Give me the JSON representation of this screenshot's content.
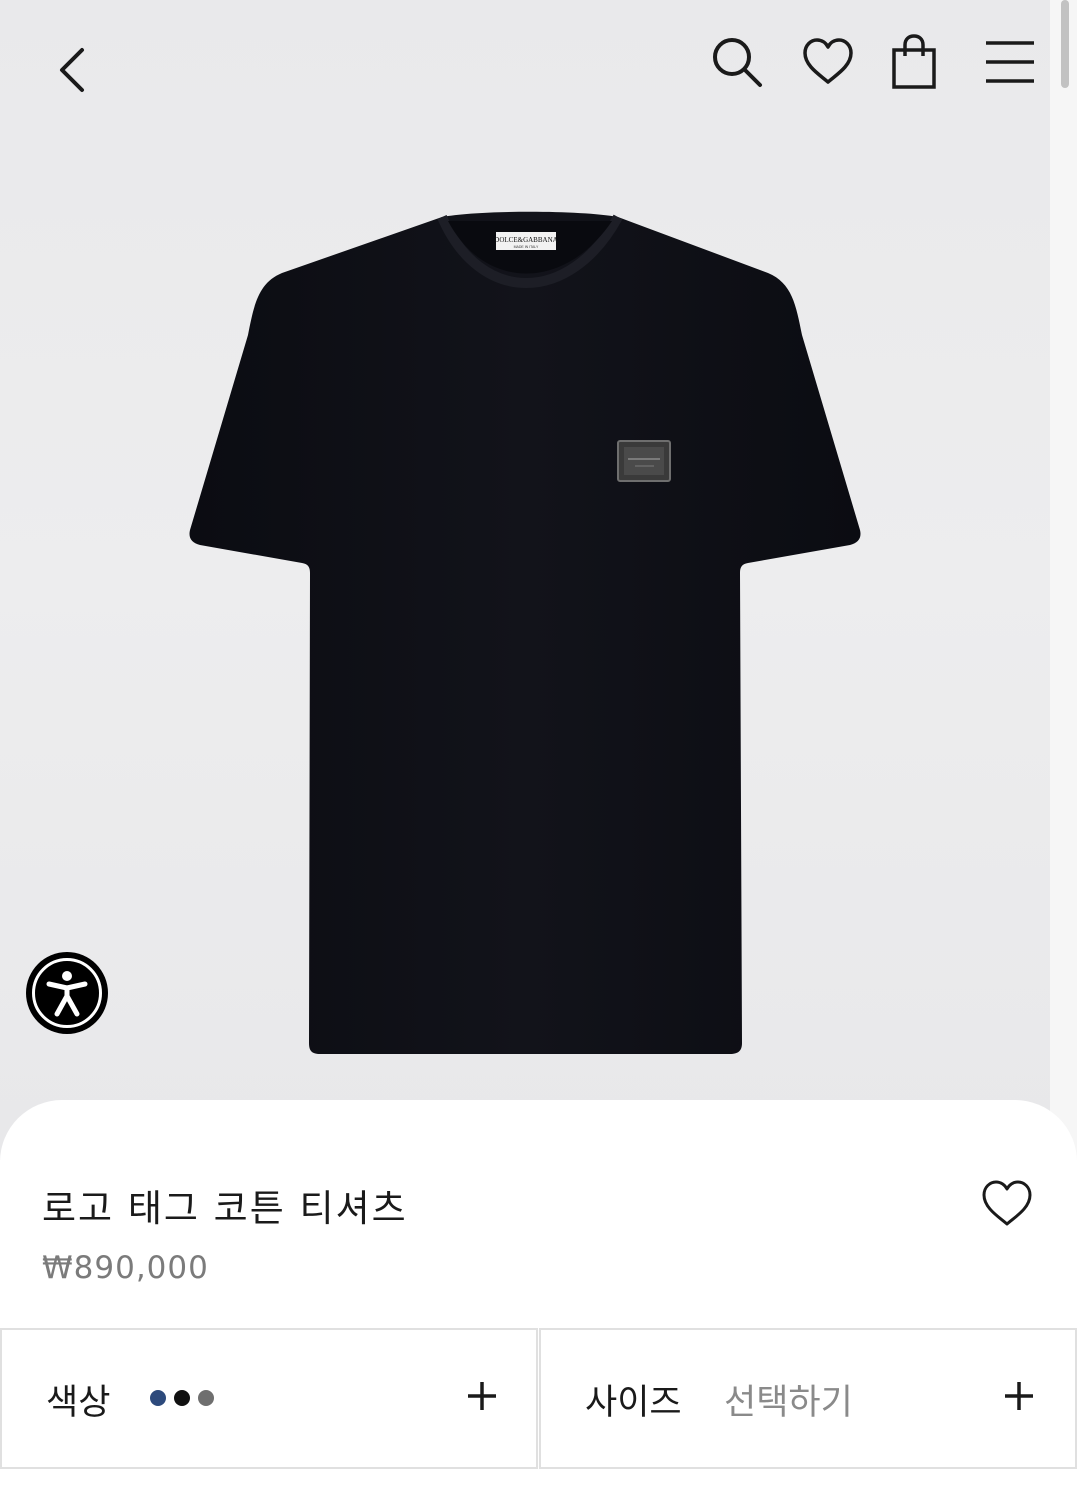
{
  "header": {
    "icons": [
      "back-arrow-icon",
      "search-icon",
      "heart-icon",
      "shopping-bag-icon",
      "hamburger-menu-icon"
    ]
  },
  "product_image": {
    "alt": "black t-shirt with logo plate",
    "brand_label_text": "DOLCE&GABBANA",
    "label_subtext": "MADE IN ITALY"
  },
  "accessibility": {
    "icon": "accessibility-person-icon"
  },
  "product": {
    "title": "로고 태그 코튼 티셔츠",
    "price": "₩890,000"
  },
  "selectors": {
    "color": {
      "label": "색상",
      "swatches": [
        "#2d4a7c",
        "#111111",
        "#6f6f6f"
      ]
    },
    "size": {
      "label": "사이즈",
      "value": "선택하기"
    }
  },
  "colors": {
    "hero_background": "#ebebed",
    "text_primary": "#1a1a1a",
    "text_secondary": "#7b7b7b",
    "border": "#e0e0e0",
    "shirt": "#0d0e14"
  }
}
